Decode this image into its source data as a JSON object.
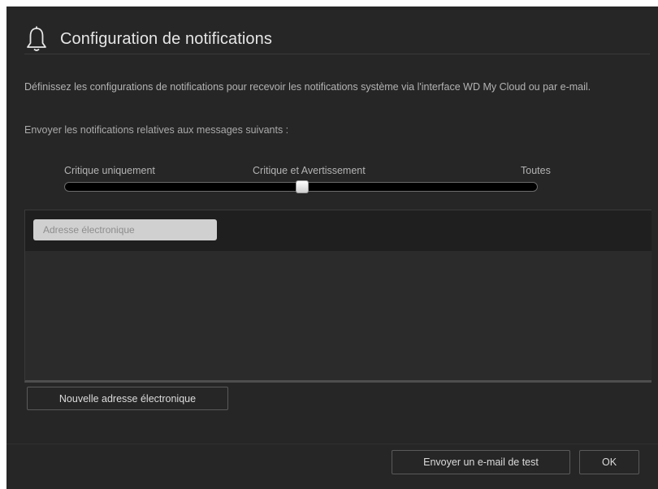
{
  "dialog": {
    "title": "Configuration de notifications",
    "icon": "bell-icon",
    "description": "Définissez les configurations de notifications pour recevoir les notifications système via l'interface WD My Cloud ou par e-mail.",
    "send_label": "Envoyer les notifications relatives aux messages suivants :"
  },
  "slider": {
    "labels": [
      "Critique uniquement",
      "Critique et Avertissement",
      "Toutes"
    ],
    "selected": "Critique et Avertissement",
    "selected_index": 1
  },
  "email": {
    "placeholder": "Adresse électronique",
    "value": ""
  },
  "buttons": {
    "new_email": "Nouvelle adresse électronique",
    "send_test": "Envoyer un e-mail de test",
    "ok": "OK"
  },
  "colors": {
    "background": "#262626",
    "text": "#b9b9b9",
    "title": "#e6e6e6"
  }
}
